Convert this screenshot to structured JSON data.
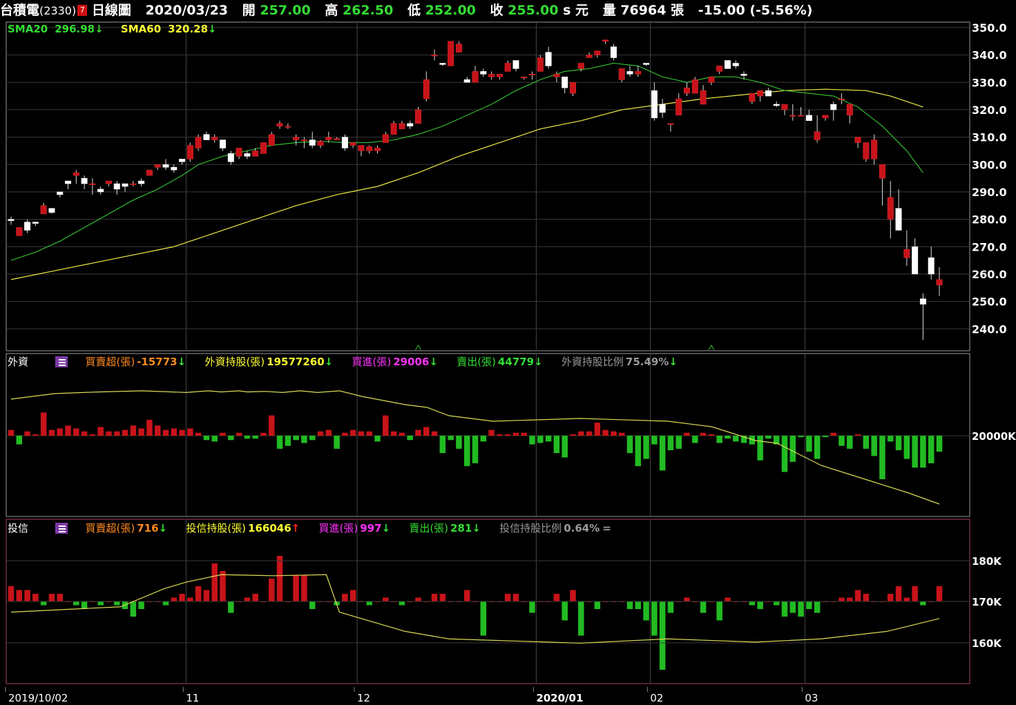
{
  "header": {
    "stock_name": "台積電",
    "stock_code": "(2330)",
    "badge": "7",
    "period": "日線圖",
    "date": "2020/03/23",
    "open_label": "開",
    "open": "257.00",
    "high_label": "高",
    "high": "262.50",
    "low_label": "低",
    "low": "252.00",
    "close_label": "收",
    "close": "255.00",
    "currency": "s 元",
    "volume_label": "量",
    "volume": "76964",
    "volume_unit": "張",
    "change": "-15.00",
    "change_pct": "(-5.56%)",
    "colors": {
      "text": "#ffffff",
      "value": "#33dd33",
      "badge": "#d01010"
    }
  },
  "price_panel": {
    "sma20_label": "SMA20",
    "sma20_value": "296.98",
    "sma60_label": "SMA60",
    "sma60_value": "320.28",
    "arrow_down": "↓",
    "arrow_up": "↑",
    "colors": {
      "up": "#c8131a",
      "down": "#ffffff",
      "sma20": "#33bb33",
      "sma60": "#eeee44",
      "grid": "#444444",
      "border": "#888888"
    }
  },
  "foreign_panel": {
    "title": "外資",
    "net_label": "買賣超(張)",
    "net_value": "-15773",
    "holding_label": "外資持股(張)",
    "holding_value": "19577260",
    "buy_label": "買進(張)",
    "buy_value": "29006",
    "sell_label": "賣出(張)",
    "sell_value": "44779",
    "ratio_label": "外資持股比例",
    "ratio_value": "75.49%",
    "y_label": "20000K",
    "icon": "menu-list-icon"
  },
  "trust_panel": {
    "title": "投信",
    "net_label": "買賣超(張)",
    "net_value": "716",
    "holding_label": "投信持股(張)",
    "holding_value": "166046",
    "buy_label": "買進(張)",
    "buy_value": "997",
    "sell_label": "賣出(張)",
    "sell_value": "281",
    "ratio_label": "投信持股比例",
    "ratio_value": "0.64%",
    "ratio_change": "=",
    "y_labels": [
      "180K",
      "170K",
      "160K"
    ],
    "icon": "menu-list-icon"
  },
  "x_axis": {
    "labels": [
      {
        "text": "2019/10/02",
        "index": 0,
        "bold": false
      },
      {
        "text": "11",
        "index": 22,
        "bold": false
      },
      {
        "text": "12",
        "index": 43,
        "bold": false
      },
      {
        "text": "2020/01",
        "index": 65,
        "bold": true
      },
      {
        "text": "02",
        "index": 79,
        "bold": false
      },
      {
        "text": "03",
        "index": 98,
        "bold": false
      }
    ]
  },
  "chart_data": {
    "type": "candlestick",
    "title": "台積電(2330) 日線圖",
    "ylim": [
      232,
      352
    ],
    "y_ticks": [
      350.0,
      340.0,
      330.0,
      320.0,
      310.0,
      300.0,
      290.0,
      280.0,
      270.0,
      260.0,
      250.0,
      240.0
    ],
    "ohlc": [
      [
        280,
        281,
        278,
        279.5
      ],
      [
        274,
        277,
        274,
        277
      ],
      [
        279,
        280,
        275,
        276
      ],
      [
        279,
        279,
        277.5,
        278.5
      ],
      [
        282,
        286,
        282,
        285
      ],
      [
        284,
        284,
        282,
        282.5
      ],
      [
        290,
        290,
        288,
        289
      ],
      [
        294,
        294,
        291,
        293
      ],
      [
        296,
        298,
        293,
        297
      ],
      [
        295,
        296,
        291,
        293
      ],
      [
        293,
        295,
        289,
        293
      ],
      [
        291,
        292,
        289,
        290
      ],
      [
        293,
        294,
        292,
        294
      ],
      [
        293,
        294,
        289,
        291
      ],
      [
        293,
        293,
        290,
        292
      ],
      [
        293,
        294,
        292,
        293
      ],
      [
        294,
        295,
        292,
        293
      ],
      [
        296,
        298,
        296,
        298
      ],
      [
        299,
        300,
        298,
        300
      ],
      [
        300,
        302,
        298,
        299
      ],
      [
        299,
        300,
        297,
        298
      ],
      [
        302,
        302,
        300,
        301
      ],
      [
        302,
        308,
        301,
        307
      ],
      [
        306,
        311,
        305,
        310
      ],
      [
        311,
        312,
        309,
        309
      ],
      [
        309,
        311,
        308,
        310
      ],
      [
        309,
        309,
        305,
        306
      ],
      [
        304,
        305,
        300,
        301
      ],
      [
        303,
        306,
        302,
        306
      ],
      [
        304,
        305,
        302,
        303
      ],
      [
        303,
        306,
        303,
        305
      ],
      [
        304,
        308,
        304,
        308
      ],
      [
        307,
        312,
        307,
        311
      ],
      [
        314,
        316,
        313,
        315
      ],
      [
        314,
        315,
        313,
        314
      ],
      [
        309,
        311,
        307,
        310
      ],
      [
        309,
        310,
        306,
        309
      ],
      [
        309,
        312,
        306,
        307
      ],
      [
        307,
        309,
        306,
        308.5
      ],
      [
        309,
        312,
        308,
        310
      ],
      [
        309,
        310,
        309,
        309.5
      ],
      [
        310,
        311,
        305,
        306
      ],
      [
        307,
        308,
        306,
        308
      ],
      [
        305,
        307,
        303,
        307
      ],
      [
        305,
        307,
        304,
        306.5
      ],
      [
        305,
        307,
        304,
        306
      ],
      [
        308,
        312,
        308,
        311
      ],
      [
        311,
        316,
        311,
        315
      ],
      [
        313,
        316,
        313,
        315
      ],
      [
        315,
        316,
        313,
        314
      ],
      [
        315,
        321,
        315,
        320
      ],
      [
        324,
        334,
        323,
        331
      ],
      [
        340,
        342,
        338,
        340
      ],
      [
        337,
        337,
        336,
        336.5
      ],
      [
        336,
        345,
        336,
        345
      ],
      [
        341,
        345,
        341,
        344
      ],
      [
        331,
        332,
        330,
        330
      ],
      [
        330,
        336,
        330,
        334
      ],
      [
        334,
        335,
        332,
        333
      ],
      [
        332,
        334,
        331,
        333
      ],
      [
        332,
        333,
        331,
        333
      ],
      [
        334,
        338,
        334,
        337
      ],
      [
        338,
        338,
        334,
        335
      ],
      [
        332,
        332,
        331,
        332
      ],
      [
        333,
        334,
        331,
        333
      ],
      [
        334,
        340,
        334,
        339
      ],
      [
        341,
        343,
        335,
        336
      ],
      [
        332,
        334,
        330,
        333
      ],
      [
        332,
        332,
        326,
        328
      ],
      [
        326,
        330,
        325,
        330
      ],
      [
        335,
        337,
        334,
        337
      ],
      [
        339,
        341,
        339,
        340
      ],
      [
        340,
        341,
        339,
        341.5
      ],
      [
        345,
        345,
        344,
        345.5
      ],
      [
        343,
        344,
        338,
        339
      ],
      [
        331,
        335,
        330,
        335
      ],
      [
        334,
        336,
        332,
        333
      ],
      [
        333,
        336,
        332,
        334
      ],
      [
        337,
        337,
        336,
        336.5
      ],
      [
        327,
        330,
        316,
        317
      ],
      [
        322,
        324,
        317,
        319
      ],
      [
        315,
        315,
        312,
        315
      ],
      [
        318,
        326,
        318,
        324
      ],
      [
        326,
        330,
        325,
        328
      ],
      [
        326,
        332,
        326,
        331
      ],
      [
        322,
        329,
        322,
        327
      ],
      [
        330,
        331,
        329,
        332
      ],
      [
        334,
        335,
        333,
        336
      ],
      [
        338,
        338,
        335,
        335
      ],
      [
        337,
        338,
        335,
        336
      ],
      [
        333,
        334,
        331,
        332.5
      ],
      [
        323,
        326,
        322,
        326
      ],
      [
        325,
        327,
        323,
        327
      ],
      [
        327,
        328,
        325,
        325
      ],
      [
        322,
        323,
        321,
        321.5
      ],
      [
        320,
        322,
        318,
        322
      ],
      [
        318,
        322,
        316,
        318
      ],
      [
        318,
        321,
        318,
        318
      ],
      [
        318,
        320,
        316,
        316
      ],
      [
        309,
        318,
        308,
        312
      ],
      [
        317,
        318,
        316,
        318
      ],
      [
        322,
        323,
        316,
        320
      ],
      [
        324,
        326,
        322,
        324
      ],
      [
        318,
        319,
        315,
        322
      ],
      [
        308,
        310,
        306,
        310
      ],
      [
        302,
        304,
        301,
        308
      ],
      [
        302,
        311,
        300,
        309
      ],
      [
        295,
        299,
        285,
        300
      ],
      [
        280,
        294,
        273,
        288
      ],
      [
        284,
        291,
        277,
        276
      ],
      [
        266,
        276,
        263,
        269
      ],
      [
        270,
        273,
        261,
        260
      ],
      [
        251,
        253,
        236,
        249
      ],
      [
        266,
        270,
        258,
        260
      ],
      [
        256,
        262.5,
        252,
        258
      ]
    ],
    "sma20": [
      [
        0,
        265
      ],
      [
        3,
        268
      ],
      [
        6,
        272
      ],
      [
        9,
        277
      ],
      [
        12,
        282
      ],
      [
        15,
        287
      ],
      [
        18,
        291
      ],
      [
        21,
        296
      ],
      [
        23,
        300
      ],
      [
        26,
        303
      ],
      [
        29,
        305
      ],
      [
        32,
        307
      ],
      [
        35,
        308
      ],
      [
        38,
        308.5
      ],
      [
        41,
        308
      ],
      [
        44,
        308
      ],
      [
        47,
        309
      ],
      [
        50,
        311
      ],
      [
        53,
        314
      ],
      [
        56,
        318
      ],
      [
        59,
        322
      ],
      [
        62,
        327
      ],
      [
        65,
        331
      ],
      [
        68,
        334
      ],
      [
        71,
        335
      ],
      [
        74,
        337
      ],
      [
        77,
        336
      ],
      [
        80,
        332
      ],
      [
        83,
        330
      ],
      [
        86,
        332
      ],
      [
        89,
        332
      ],
      [
        92,
        330
      ],
      [
        95,
        327
      ],
      [
        98,
        326
      ],
      [
        101,
        325
      ],
      [
        104,
        321
      ],
      [
        107,
        314
      ],
      [
        110,
        305
      ],
      [
        112,
        297
      ]
    ],
    "sma60": [
      [
        0,
        258
      ],
      [
        5,
        261
      ],
      [
        10,
        264
      ],
      [
        15,
        267
      ],
      [
        20,
        270
      ],
      [
        25,
        275
      ],
      [
        30,
        280
      ],
      [
        35,
        285
      ],
      [
        40,
        289
      ],
      [
        45,
        292
      ],
      [
        50,
        297
      ],
      [
        55,
        303
      ],
      [
        60,
        308
      ],
      [
        65,
        313
      ],
      [
        70,
        316
      ],
      [
        75,
        320
      ],
      [
        80,
        322
      ],
      [
        85,
        324
      ],
      [
        90,
        325.5
      ],
      [
        95,
        327
      ],
      [
        100,
        327.5
      ],
      [
        105,
        327
      ],
      [
        108,
        325
      ],
      [
        112,
        321
      ]
    ],
    "foreign_net_k": [
      4,
      -6,
      3,
      1,
      16,
      4,
      5,
      7,
      5,
      3,
      1,
      6,
      3,
      3,
      4,
      7,
      5,
      11,
      7,
      4,
      5,
      4,
      5,
      2,
      -3,
      -4,
      2,
      -3,
      2,
      -2,
      -2,
      2,
      14,
      -9,
      -7,
      -3,
      -5,
      -3,
      3,
      4,
      -9,
      2,
      4,
      3,
      3,
      -4,
      14,
      3,
      2,
      -3,
      4,
      6,
      3,
      -12,
      -3,
      -9,
      -21,
      -19,
      -4,
      4,
      1,
      1,
      2,
      2,
      -6,
      -5,
      -4,
      -12,
      -15,
      1,
      3,
      3,
      9,
      4,
      3,
      2,
      -12,
      -21,
      -16,
      -6,
      -24,
      -10,
      -9,
      2,
      -5,
      2,
      1,
      -5,
      -2,
      -4,
      -5,
      -6,
      -17,
      -2,
      -6,
      -25,
      -18,
      -1,
      -11,
      -16,
      -1,
      2,
      -7,
      -9,
      1,
      -9,
      -14,
      -30,
      -4,
      -10,
      -16,
      -22,
      -22,
      -19,
      -11,
      -17,
      -14,
      -19,
      -5
    ],
    "foreign_holding_pct_norm": [
      [
        0,
        0.1
      ],
      [
        5,
        0.05
      ],
      [
        10,
        0.0
      ],
      [
        20,
        -0.03
      ],
      [
        30,
        -0.05
      ],
      [
        40,
        -0.02
      ],
      [
        45,
        -0.05
      ],
      [
        48,
        -0.03
      ],
      [
        52,
        -0.05
      ],
      [
        54,
        -0.03
      ],
      [
        58,
        -0.04
      ],
      [
        62,
        -0.02
      ],
      [
        66,
        -0.05
      ],
      [
        70,
        -0.02
      ],
      [
        75,
        -0.05
      ],
      [
        80,
        0.05
      ],
      [
        90,
        0.2
      ],
      [
        95,
        0.25
      ],
      [
        100,
        0.4
      ],
      [
        110,
        0.5
      ],
      [
        130,
        0.45
      ],
      [
        150,
        0.5
      ],
      [
        160,
        0.6
      ],
      [
        170,
        0.85
      ],
      [
        175,
        0.9
      ],
      [
        185,
        1.3
      ],
      [
        195,
        1.55
      ],
      [
        205,
        1.8
      ],
      [
        212,
        2.0
      ]
    ],
    "trust_net_k": [
      4,
      3,
      3,
      2,
      -1,
      2,
      2,
      0,
      -1,
      -2,
      0,
      -1,
      0,
      -1,
      -2,
      -4,
      -2,
      0,
      0,
      -1,
      1,
      2,
      1,
      4,
      3,
      10,
      8,
      -3,
      0,
      1,
      2,
      0,
      6,
      12,
      0,
      7,
      7,
      -2,
      0,
      0,
      -1,
      2,
      3,
      0,
      -1,
      0,
      1,
      0,
      -1,
      0,
      1,
      0,
      2,
      2,
      0,
      0,
      3,
      0,
      -9,
      0,
      0,
      2,
      2,
      0,
      -3,
      0,
      0,
      2,
      -5,
      3,
      -9,
      0,
      -2,
      0,
      0,
      0,
      -2,
      -2,
      -5,
      -9,
      -18,
      -3,
      0,
      1,
      0,
      -3,
      0,
      -5,
      1,
      0,
      0,
      -1,
      -2,
      0,
      -1,
      -4,
      -3,
      -4,
      -2,
      -3,
      0,
      0,
      1,
      1,
      3,
      2,
      0,
      0,
      2,
      4,
      1,
      4,
      -1,
      0,
      4,
      6,
      10,
      15,
      5
    ],
    "trust_holding_pct_norm": [
      [
        0,
        -0.1
      ],
      [
        25,
        -0.05
      ],
      [
        35,
        0.12
      ],
      [
        40,
        0.18
      ],
      [
        48,
        0.25
      ],
      [
        60,
        0.24
      ],
      [
        72,
        0.25
      ],
      [
        75,
        -0.1
      ],
      [
        90,
        -0.28
      ],
      [
        100,
        -0.35
      ],
      [
        130,
        -0.39
      ],
      [
        150,
        -0.35
      ],
      [
        170,
        -0.38
      ],
      [
        185,
        -0.35
      ],
      [
        200,
        -0.28
      ],
      [
        212,
        -0.16
      ]
    ]
  }
}
